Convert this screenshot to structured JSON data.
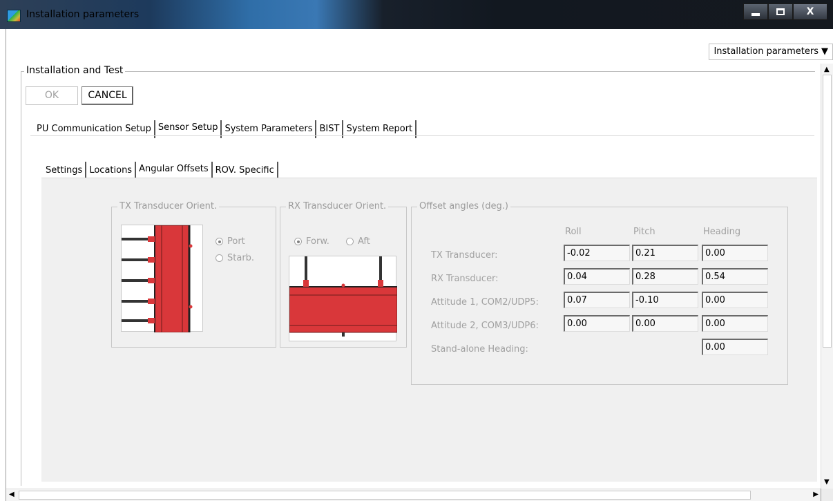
{
  "window": {
    "title": "Installation parameters",
    "minimize_glyph": "—",
    "maximize_glyph": "☐",
    "close_glyph": "X"
  },
  "view_selector": {
    "value": "Installation parameters",
    "caret": "▼"
  },
  "group": {
    "legend": "Installation and Test",
    "ok_label": "OK",
    "cancel_label": "CANCEL"
  },
  "main_tabs": [
    {
      "label": "PU Communication Setup"
    },
    {
      "label": "Sensor Setup",
      "active": true
    },
    {
      "label": "System Parameters"
    },
    {
      "label": "BIST"
    },
    {
      "label": "System Report"
    }
  ],
  "sub_tabs": [
    {
      "label": "Settings"
    },
    {
      "label": "Locations"
    },
    {
      "label": "Angular Offsets",
      "active": true
    },
    {
      "label": "ROV. Specific"
    }
  ],
  "tx_orient": {
    "legend": "TX Transducer Orient.",
    "options": [
      {
        "label": "Port",
        "selected": true
      },
      {
        "label": "Starb.",
        "selected": false
      }
    ]
  },
  "rx_orient": {
    "legend": "RX Transducer Orient.",
    "options": [
      {
        "label": "Forw.",
        "selected": true
      },
      {
        "label": "Aft",
        "selected": false
      }
    ]
  },
  "offsets": {
    "legend": "Offset angles (deg.)",
    "columns": [
      "Roll",
      "Pitch",
      "Heading"
    ],
    "rows": [
      {
        "label": "TX Transducer:",
        "values": [
          "-0.02",
          "0.21",
          "0.00"
        ]
      },
      {
        "label": "RX Transducer:",
        "values": [
          "0.04",
          "0.28",
          "0.54"
        ]
      },
      {
        "label": "Attitude 1, COM2/UDP5:",
        "values": [
          "0.07",
          "-0.10",
          "0.00"
        ]
      },
      {
        "label": "Attitude 2, COM3/UDP6:",
        "values": [
          "0.00",
          "0.00",
          "0.00"
        ]
      },
      {
        "label": "Stand-alone Heading:",
        "values": [
          "",
          "",
          "0.00"
        ]
      }
    ]
  },
  "colors": {
    "transducer_red": "#d9373a",
    "panel_bg": "#f0f0f0",
    "disabled_text": "#a0a0a0"
  }
}
